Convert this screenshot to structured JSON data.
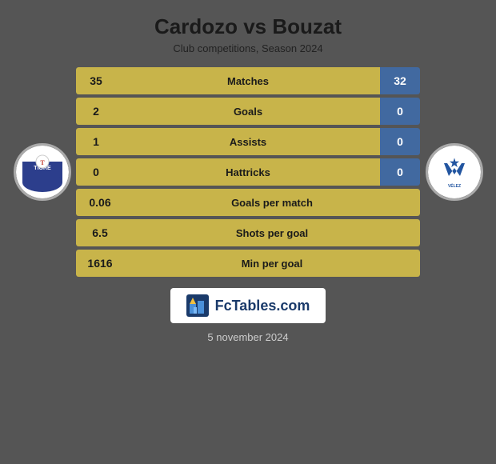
{
  "header": {
    "title": "Cardozo vs Bouzat",
    "subtitle": "Club competitions, Season 2024"
  },
  "stats": [
    {
      "label": "Matches",
      "left": "35",
      "right": "32",
      "single": false
    },
    {
      "label": "Goals",
      "left": "2",
      "right": "0",
      "single": false
    },
    {
      "label": "Assists",
      "left": "1",
      "right": "0",
      "single": false
    },
    {
      "label": "Hattricks",
      "left": "0",
      "right": "0",
      "single": false
    },
    {
      "label": "Goals per match",
      "left": "0.06",
      "right": null,
      "single": true
    },
    {
      "label": "Shots per goal",
      "left": "6.5",
      "right": null,
      "single": true
    },
    {
      "label": "Min per goal",
      "left": "1616",
      "right": null,
      "single": true
    }
  ],
  "fctables": {
    "text": "FcTables.com"
  },
  "footer": {
    "date": "5 november 2024"
  }
}
